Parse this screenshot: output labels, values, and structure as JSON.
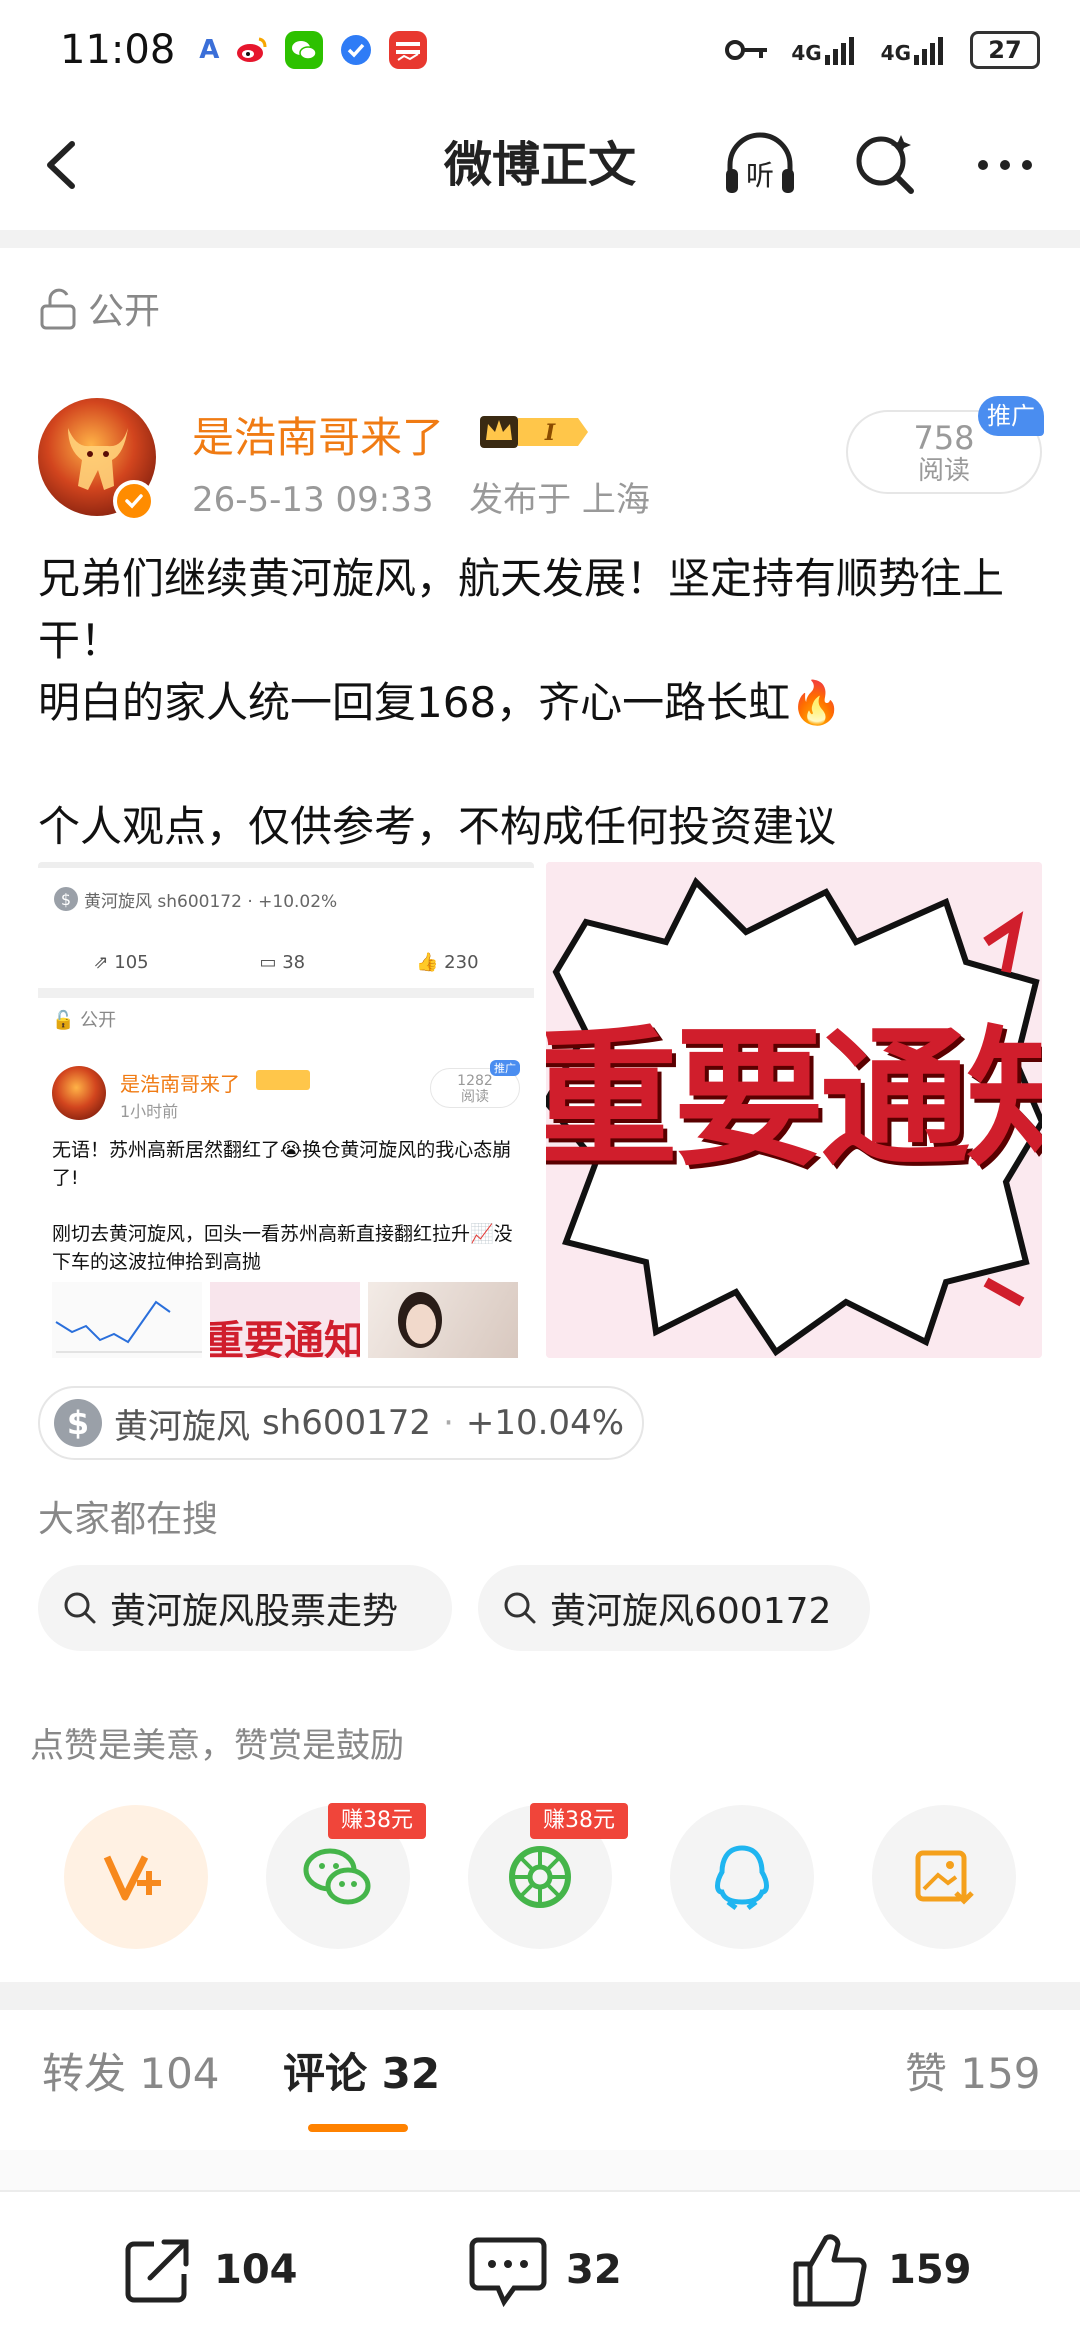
{
  "status_bar": {
    "time": "11:08",
    "net1": "4G",
    "net2": "4G",
    "battery": "27"
  },
  "nav": {
    "title": "微博正文",
    "listen_label": "听"
  },
  "post": {
    "visibility": "公开",
    "author": "是浩南哥来了",
    "level_badge": "I",
    "date": "26-5-13 09:33",
    "location": "发布于 上海",
    "read_count": "758",
    "read_label": "阅读",
    "promo_tag": "推广",
    "lines": [
      "兄弟们继续黄河旋风，航天发展！坚定持有顺势往上干！",
      "明白的家人统一回复168，齐心一路长虹🔥",
      "",
      "个人观点，仅供参考，不构成任何投资建议"
    ]
  },
  "embedded_screenshot": {
    "stock_tag": "黄河旋风 sh600172 · +10.02%",
    "repost": "105",
    "comment": "38",
    "like": "230",
    "visibility": "公开",
    "author": "是浩南哥来了",
    "read_count": "1282",
    "read_label": "阅读",
    "promo": "推广",
    "time": "1小时前",
    "text1": "无语！苏州高新居然翻红了😭换仓黄河旋风的我心态崩了!",
    "text2": "刚切去黄河旋风，回头一看苏州高新直接翻红拉升📈没下车的这波拉伸拾到高抛",
    "banner_partial": "重要通知"
  },
  "right_image": {
    "banner_text": "重要通知"
  },
  "stock": {
    "icon": "$",
    "name": "黄河旋风",
    "code": "sh600172",
    "change": "+10.04%"
  },
  "search": {
    "title": "大家都在搜",
    "chips": [
      "黄河旋风股票走势",
      "黄河旋风600172"
    ]
  },
  "tip": "点赞是美意，赞赏是鼓励",
  "share": {
    "earn_tags": [
      "赚38元",
      "赚38元"
    ]
  },
  "tabs": {
    "repost": "转发 104",
    "comment": "评论 32",
    "like": "赞 159"
  },
  "bottom": {
    "repost": "104",
    "comment": "32",
    "like": "159"
  },
  "colors": {
    "accent": "#ff8200",
    "author": "#f07b13",
    "earn_tag": "#f0453a",
    "promo": "#4a8df0"
  }
}
